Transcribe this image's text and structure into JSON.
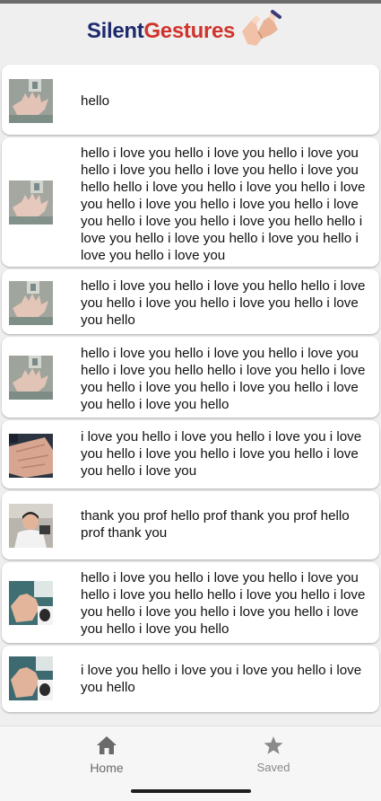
{
  "app": {
    "title_part1": "Silent",
    "title_part2": "Gestures"
  },
  "logo": {
    "icon": "heart-hands-icon"
  },
  "messages": [
    {
      "thumb": "open-palm",
      "text": "hello"
    },
    {
      "thumb": "open-palm",
      "text": "hello i love you hello i love you hello i love you hello i love you hello i love you hello i love you hello hello i love you hello i love you hello i love you hello i love you hello i love you hello i love you hello i love you hello i love you hello hello i love you hello i love you hello i love you hello i love you hello i love you"
    },
    {
      "thumb": "open-palm",
      "text": "hello i love you hello i love you hello hello i love you hello i love you hello i love you hello i love you hello"
    },
    {
      "thumb": "open-palm",
      "text": "hello i love you hello i love you hello i love you hello i love you hello hello i love you hello i love you hello i love you hello i love you hello i love you hello i love you hello"
    },
    {
      "thumb": "palm-closeup",
      "text": "i love you hello i love you hello i love you i love you hello i love you hello i love you hello i love you hello i love you"
    },
    {
      "thumb": "person",
      "text": "thank you prof hello prof thank you prof hello prof thank you"
    },
    {
      "thumb": "hand-desk",
      "text": "hello i love you hello i love you hello i love you hello i love you hello hello i love you hello i love you hello i love you hello i love you hello i love you hello i love you hello"
    },
    {
      "thumb": "hand-desk",
      "text": "i love you hello i love you i love you hello i love you hello"
    }
  ],
  "tabs": [
    {
      "label": "Home",
      "icon": "home-icon"
    },
    {
      "label": "Saved",
      "icon": "star-icon"
    }
  ],
  "colors": {
    "brand_dark": "#1d2a6e",
    "brand_red": "#d0342c",
    "background": "#efefef",
    "card": "#ffffff"
  }
}
